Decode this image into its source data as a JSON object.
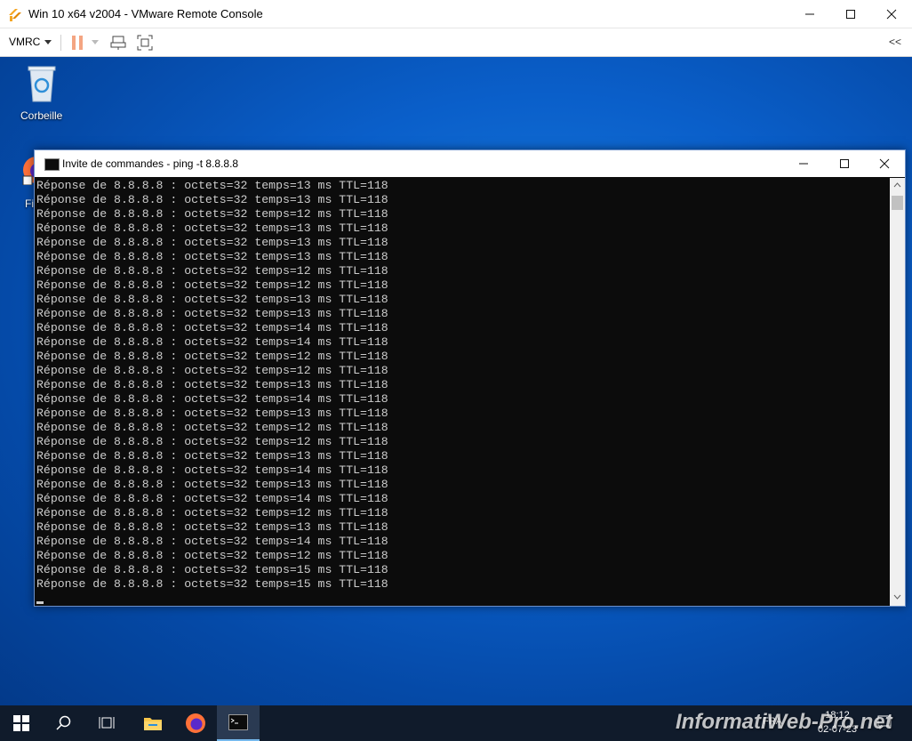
{
  "vmrc": {
    "title": "Win 10 x64 v2004 - VMware Remote Console",
    "menu_label": "VMRC",
    "collapse_label": "<<"
  },
  "desktop": {
    "icons": [
      {
        "label": "Corbeille",
        "icon": "recycle-bin-icon"
      },
      {
        "label": "Fi",
        "icon": "firefox-shortcut-icon"
      }
    ]
  },
  "cmd": {
    "title": "Invite de commandes - ping  -t 8.8.8.8",
    "lines": [
      "Réponse de 8.8.8.8 : octets=32 temps=13 ms TTL=118",
      "Réponse de 8.8.8.8 : octets=32 temps=13 ms TTL=118",
      "Réponse de 8.8.8.8 : octets=32 temps=12 ms TTL=118",
      "Réponse de 8.8.8.8 : octets=32 temps=13 ms TTL=118",
      "Réponse de 8.8.8.8 : octets=32 temps=13 ms TTL=118",
      "Réponse de 8.8.8.8 : octets=32 temps=13 ms TTL=118",
      "Réponse de 8.8.8.8 : octets=32 temps=12 ms TTL=118",
      "Réponse de 8.8.8.8 : octets=32 temps=12 ms TTL=118",
      "Réponse de 8.8.8.8 : octets=32 temps=13 ms TTL=118",
      "Réponse de 8.8.8.8 : octets=32 temps=13 ms TTL=118",
      "Réponse de 8.8.8.8 : octets=32 temps=14 ms TTL=118",
      "Réponse de 8.8.8.8 : octets=32 temps=14 ms TTL=118",
      "Réponse de 8.8.8.8 : octets=32 temps=12 ms TTL=118",
      "Réponse de 8.8.8.8 : octets=32 temps=12 ms TTL=118",
      "Réponse de 8.8.8.8 : octets=32 temps=13 ms TTL=118",
      "Réponse de 8.8.8.8 : octets=32 temps=14 ms TTL=118",
      "Réponse de 8.8.8.8 : octets=32 temps=13 ms TTL=118",
      "Réponse de 8.8.8.8 : octets=32 temps=12 ms TTL=118",
      "Réponse de 8.8.8.8 : octets=32 temps=12 ms TTL=118",
      "Réponse de 8.8.8.8 : octets=32 temps=13 ms TTL=118",
      "Réponse de 8.8.8.8 : octets=32 temps=14 ms TTL=118",
      "Réponse de 8.8.8.8 : octets=32 temps=13 ms TTL=118",
      "Réponse de 8.8.8.8 : octets=32 temps=14 ms TTL=118",
      "Réponse de 8.8.8.8 : octets=32 temps=12 ms TTL=118",
      "Réponse de 8.8.8.8 : octets=32 temps=13 ms TTL=118",
      "Réponse de 8.8.8.8 : octets=32 temps=14 ms TTL=118",
      "Réponse de 8.8.8.8 : octets=32 temps=12 ms TTL=118",
      "Réponse de 8.8.8.8 : octets=32 temps=15 ms TTL=118",
      "Réponse de 8.8.8.8 : octets=32 temps=15 ms TTL=118"
    ]
  },
  "taskbar": {
    "items": [
      "start-icon",
      "search-icon",
      "task-view-icon",
      "file-explorer-icon",
      "firefox-icon",
      "command-prompt-icon"
    ],
    "lang": "FRA",
    "time": "18:12",
    "date": "02-07-23"
  },
  "watermark": "InformatiWeb-Pro.net",
  "colors": {
    "desktop_blue": "#0a5fca",
    "cmd_bg": "#0c0c0c",
    "cmd_text": "#cccccc",
    "taskbar": "#101b2b",
    "pause_orange": "#f4a582"
  }
}
